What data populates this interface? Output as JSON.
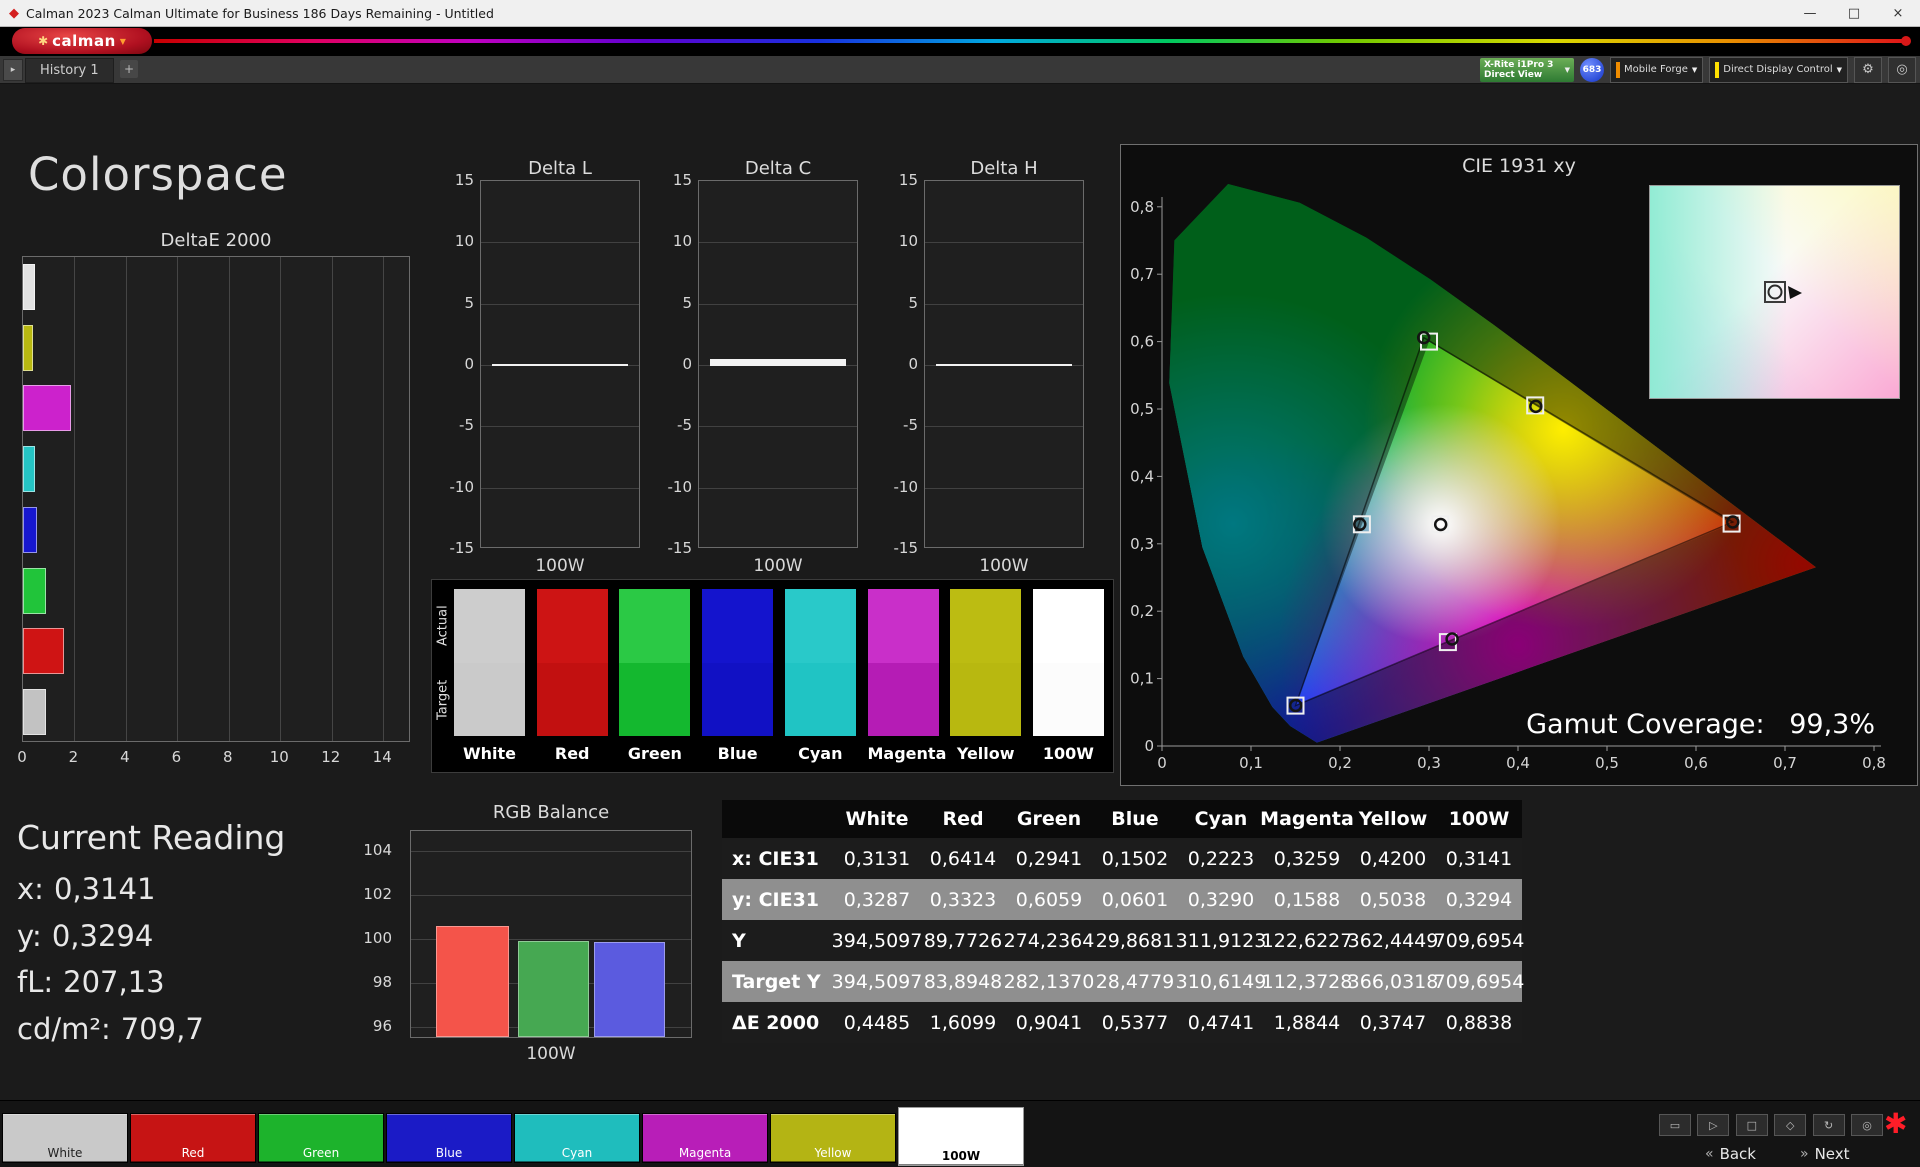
{
  "titlebar": {
    "app_icon": "◆",
    "title": "Calman 2023 Calman Ultimate for Business 186 Days Remaining  - Untitled",
    "minimize": "—",
    "maximize": "□",
    "close": "×"
  },
  "logobar": {
    "logo_symbol": "✱",
    "logo_text": "calman",
    "dropdown_arrow": "▼"
  },
  "tabbar": {
    "nav_arrow": "▸",
    "history_tab": "History 1",
    "add_tab": "+",
    "meter": {
      "line1": "X-Rite i1Pro 3",
      "line2": "Direct View",
      "arrow": "▼"
    },
    "meter_badge": "683",
    "source": {
      "label": "Mobile Forge",
      "arrow": "▼",
      "stripe_color": "#f08c00"
    },
    "display_control": {
      "label": "Direct Display Control",
      "arrow": "▼",
      "stripe_color": "#ffe000"
    },
    "settings_icon": "⚙",
    "power_icon": "◎"
  },
  "main": {
    "page_title": "Colorspace",
    "deltae": {
      "title": "DeltaE 2000",
      "xticks": [
        "0",
        "2",
        "4",
        "6",
        "8",
        "10",
        "12",
        "14"
      ],
      "bars": [
        {
          "name": "White",
          "value": 0.4485,
          "color": "#e2e2e2"
        },
        {
          "name": "Yellow",
          "value": 0.3747,
          "color": "#b9b911"
        },
        {
          "name": "Magenta",
          "value": 1.8844,
          "color": "#cc22cc"
        },
        {
          "name": "Cyan",
          "value": 0.4741,
          "color": "#25c4c4"
        },
        {
          "name": "Blue",
          "value": 0.5377,
          "color": "#1717cf"
        },
        {
          "name": "Green",
          "value": 0.9041,
          "color": "#21c43a"
        },
        {
          "name": "Red",
          "value": 1.6099,
          "color": "#cf1414"
        },
        {
          "name": "100W",
          "value": 0.8838,
          "color": "#c2c2c2"
        }
      ]
    },
    "delta_axis": [
      "15",
      "10",
      "5",
      "0",
      "-5",
      "-10",
      "-15"
    ],
    "delta_charts": [
      {
        "title": "Delta L",
        "xlabel": "100W",
        "value": 0.1
      },
      {
        "title": "Delta C",
        "xlabel": "100W",
        "value": 0.55
      },
      {
        "title": "Delta H",
        "xlabel": "100W",
        "value": 0.1
      }
    ],
    "swatches": {
      "actual_label": "Actual",
      "target_label": "Target",
      "items": [
        {
          "name": "White",
          "actual": "#cdcdcd",
          "target": "#cacaca"
        },
        {
          "name": "Red",
          "actual": "#cd1414",
          "target": "#c21010"
        },
        {
          "name": "Green",
          "actual": "#2bc945",
          "target": "#14b82f"
        },
        {
          "name": "Blue",
          "actual": "#1414cd",
          "target": "#1111c4"
        },
        {
          "name": "Cyan",
          "actual": "#29c9c9",
          "target": "#20c4c4"
        },
        {
          "name": "Magenta",
          "actual": "#c92fc9",
          "target": "#b51cb5"
        },
        {
          "name": "Yellow",
          "actual": "#bcbc12",
          "target": "#b8b810"
        },
        {
          "name": "100W",
          "actual": "#ffffff",
          "target": "#fcfcfc"
        }
      ]
    },
    "cie": {
      "title": "CIE 1931 xy",
      "xticks": [
        "0",
        "0,1",
        "0,2",
        "0,3",
        "0,4",
        "0,5",
        "0,6",
        "0,7",
        "0,8"
      ],
      "yticks": [
        "0,8",
        "0,7",
        "0,6",
        "0,5",
        "0,4",
        "0,3",
        "0,2",
        "0,1",
        "0"
      ],
      "gamut_label": "Gamut Coverage:",
      "gamut_value": "99,3%",
      "locus": [
        [
          0.1741,
          0.005
        ],
        [
          0.144,
          0.0297
        ],
        [
          0.1241,
          0.0578
        ],
        [
          0.0913,
          0.1327
        ],
        [
          0.0454,
          0.295
        ],
        [
          0.0082,
          0.5384
        ],
        [
          0.0139,
          0.7502
        ],
        [
          0.0743,
          0.8338
        ],
        [
          0.1547,
          0.8059
        ],
        [
          0.2296,
          0.7543
        ],
        [
          0.3016,
          0.6923
        ],
        [
          0.3731,
          0.6245
        ],
        [
          0.4441,
          0.5547
        ],
        [
          0.5125,
          0.4866
        ],
        [
          0.5752,
          0.4242
        ],
        [
          0.627,
          0.3725
        ],
        [
          0.6915,
          0.3083
        ],
        [
          0.7347,
          0.2653
        ]
      ],
      "reference_triangle": {
        "red": [
          0.64,
          0.33
        ],
        "green": [
          0.3,
          0.6
        ],
        "blue": [
          0.15,
          0.06
        ]
      },
      "points": [
        {
          "name": "White",
          "x": 0.3131,
          "y": 0.3287,
          "tx": 0.3127,
          "ty": 0.329
        },
        {
          "name": "Red",
          "x": 0.6414,
          "y": 0.3323,
          "tx": 0.64,
          "ty": 0.33
        },
        {
          "name": "Green",
          "x": 0.2941,
          "y": 0.6059,
          "tx": 0.3,
          "ty": 0.6
        },
        {
          "name": "Blue",
          "x": 0.1502,
          "y": 0.0601,
          "tx": 0.15,
          "ty": 0.06
        },
        {
          "name": "Cyan",
          "x": 0.2223,
          "y": 0.329,
          "tx": 0.2246,
          "ty": 0.329
        },
        {
          "name": "Magenta",
          "x": 0.3259,
          "y": 0.1588,
          "tx": 0.3212,
          "ty": 0.1542
        },
        {
          "name": "Yellow",
          "x": 0.42,
          "y": 0.5038,
          "tx": 0.4193,
          "ty": 0.5053
        }
      ]
    },
    "current_reading": {
      "title": "Current Reading",
      "items": [
        {
          "label": "x:",
          "value": "0,3141"
        },
        {
          "label": "y:",
          "value": "0,3294"
        },
        {
          "label": "fL:",
          "value": "207,13"
        },
        {
          "label": "cd/m²:",
          "value": "709,7"
        }
      ]
    },
    "rgb_balance": {
      "title": "RGB Balance",
      "xlabel": "100W",
      "yticks": [
        "104",
        "102",
        "100",
        "98",
        "96"
      ],
      "bars": [
        {
          "name": "Red",
          "value": 100.6,
          "color": "#f4544a"
        },
        {
          "name": "Green",
          "value": 99.9,
          "color": "#46a852"
        },
        {
          "name": "Blue",
          "value": 99.85,
          "color": "#5b5bdf"
        }
      ]
    },
    "table": {
      "columns": [
        "",
        "White",
        "Red",
        "Green",
        "Blue",
        "Cyan",
        "Magenta",
        "Yellow",
        "100W"
      ],
      "rows": [
        {
          "label": "x: CIE31",
          "shade": "dark",
          "values": [
            "0,3131",
            "0,6414",
            "0,2941",
            "0,1502",
            "0,2223",
            "0,3259",
            "0,4200",
            "0,3141"
          ]
        },
        {
          "label": "y: CIE31",
          "shade": "light",
          "values": [
            "0,3287",
            "0,3323",
            "0,6059",
            "0,0601",
            "0,3290",
            "0,1588",
            "0,5038",
            "0,3294"
          ]
        },
        {
          "label": "Y",
          "shade": "dark",
          "values": [
            "394,5097",
            "89,7726",
            "274,2364",
            "29,8681",
            "311,9123",
            "122,6227",
            "362,4449",
            "709,6954"
          ]
        },
        {
          "label": "Target Y",
          "shade": "light",
          "values": [
            "394,5097",
            "83,8948",
            "282,1370",
            "28,4779",
            "310,6149",
            "112,3728",
            "366,0318",
            "709,6954"
          ]
        },
        {
          "label": "ΔE 2000",
          "shade": "dark",
          "values": [
            "0,4485",
            "1,6099",
            "0,9041",
            "0,5377",
            "0,4741",
            "1,8844",
            "0,3747",
            "0,8838"
          ]
        }
      ]
    }
  },
  "bottombar": {
    "patches": [
      {
        "label": "White",
        "color": "#c9c9c9",
        "label_color": "#222222",
        "selected": false
      },
      {
        "label": "Red",
        "color": "#c61414",
        "label_color": "#ffffff",
        "selected": false
      },
      {
        "label": "Green",
        "color": "#1db32c",
        "label_color": "#ffffff",
        "selected": false
      },
      {
        "label": "Blue",
        "color": "#1b1bc6",
        "label_color": "#ffffff",
        "selected": false
      },
      {
        "label": "Cyan",
        "color": "#1fbdbd",
        "label_color": "#ffffff",
        "selected": false
      },
      {
        "label": "Magenta",
        "color": "#b81eb8",
        "label_color": "#ffffff",
        "selected": false
      },
      {
        "label": "Yellow",
        "color": "#b4b414",
        "label_color": "#ffffff",
        "selected": false
      },
      {
        "label": "100W",
        "color": "#ffffff",
        "label_color": "#000000",
        "selected": true
      }
    ],
    "toolbar": [
      {
        "name": "layout",
        "glyph": "▭"
      },
      {
        "name": "play",
        "glyph": "▷"
      },
      {
        "name": "stop",
        "glyph": "□"
      },
      {
        "name": "pattern",
        "glyph": "◇"
      },
      {
        "name": "loop",
        "glyph": "↻"
      },
      {
        "name": "power",
        "glyph": "◎"
      }
    ],
    "back_icon": "«",
    "back_label": "Back",
    "next_icon": "»",
    "next_label": "Next",
    "busy_glyph": "✱"
  }
}
